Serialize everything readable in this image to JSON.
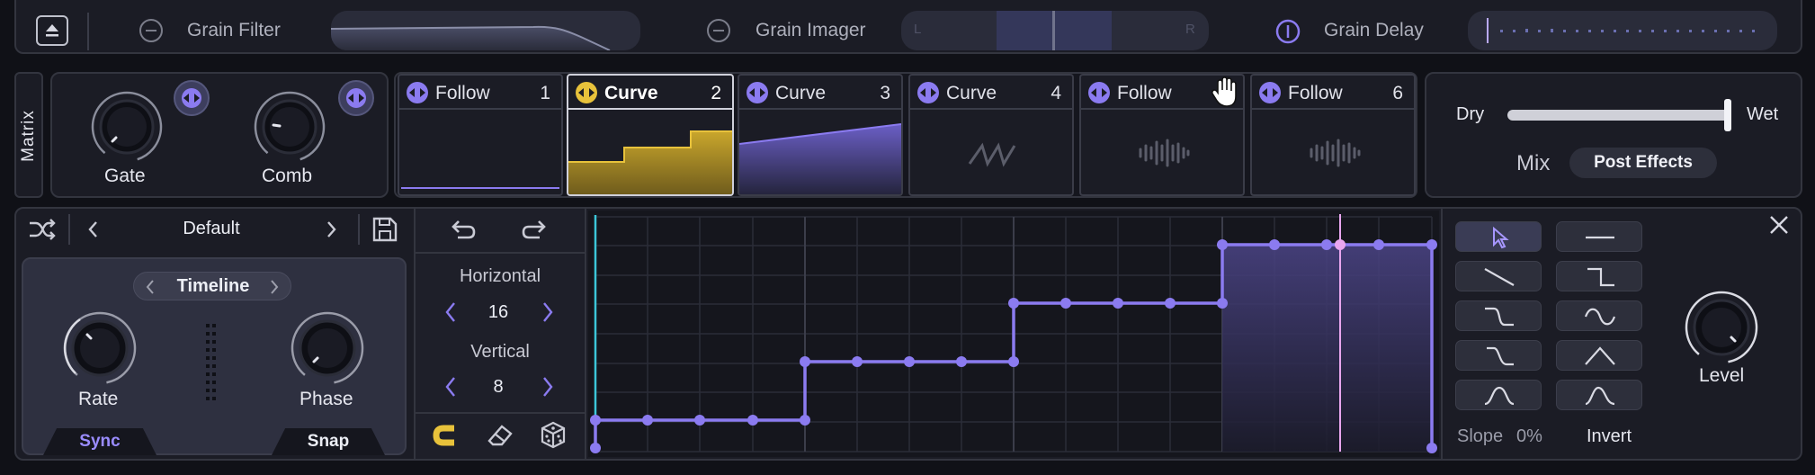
{
  "effects_bar": {
    "grain_filter": {
      "label": "Grain Filter"
    },
    "grain_imager": {
      "label": "Grain Imager",
      "left": "L",
      "right": "R"
    },
    "grain_delay": {
      "label": "Grain Delay"
    }
  },
  "matrix": {
    "tab_label": "Matrix",
    "knobs": [
      {
        "label": "Gate"
      },
      {
        "label": "Comb"
      }
    ],
    "slots": [
      {
        "name": "Follow",
        "num": "1"
      },
      {
        "name": "Curve",
        "num": "2"
      },
      {
        "name": "Curve",
        "num": "3"
      },
      {
        "name": "Curve",
        "num": "4"
      },
      {
        "name": "Follow",
        "num": ""
      },
      {
        "name": "Follow",
        "num": "6"
      }
    ],
    "active_slot": 2
  },
  "mix": {
    "dry_label": "Dry",
    "wet_label": "Wet",
    "mix_label": "Mix",
    "mode_button": "Post Effects",
    "value": 0.98
  },
  "preset": {
    "name": "Default"
  },
  "lfo": {
    "timeline_label": "Timeline",
    "rate_label": "Rate",
    "phase_label": "Phase",
    "sync_label": "Sync",
    "snap_label": "Snap"
  },
  "grid": {
    "horizontal_label": "Horizontal",
    "horizontal_value": "16",
    "vertical_label": "Vertical",
    "vertical_value": "8"
  },
  "shapes": {
    "slope_label": "Slope",
    "slope_value": "0%",
    "invert_label": "Invert"
  },
  "level": {
    "label": "Level"
  },
  "colors": {
    "accent": "#8b7bf0",
    "curve_yellow": "#e8c23b",
    "playhead": "#e9a6ef",
    "start_line": "#3cc6d8",
    "background": "#101117",
    "panel": "#1b1c25"
  },
  "icons": [
    "collapse-icon",
    "minus-circle-icon",
    "power-icon",
    "link-arrows-icon",
    "hand-cursor-icon",
    "shuffle-icon",
    "chevron-left-icon",
    "chevron-right-icon",
    "save-icon",
    "undo-icon",
    "redo-icon",
    "magnet-icon",
    "eraser-icon",
    "dice-icon",
    "close-icon",
    "pointer-icon",
    "dots-grip-icon"
  ]
}
